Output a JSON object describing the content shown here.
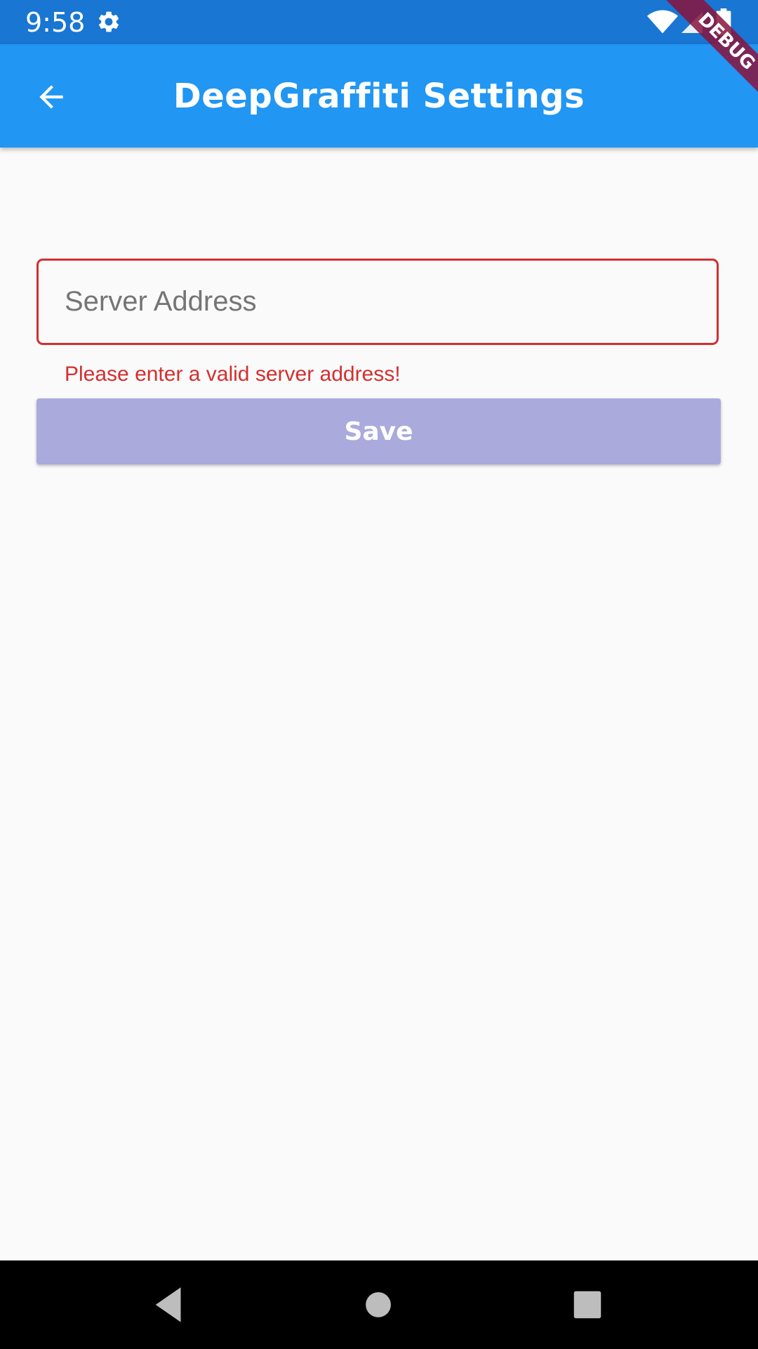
{
  "status_bar": {
    "time": "9:58",
    "icons": [
      "gear-icon",
      "wifi-icon",
      "signal-icon",
      "battery-icon"
    ]
  },
  "app_bar": {
    "title": "DeepGraffiti Settings",
    "back_icon": "arrow-back-icon",
    "color": "#2196f3"
  },
  "debug_banner": {
    "label": "DEBUG"
  },
  "form": {
    "server_address": {
      "placeholder": "Server Address",
      "value": "",
      "error": "Please enter a valid server address!"
    },
    "save_label": "Save"
  },
  "colors": {
    "status_bar": "#1976d2",
    "error": "#d32f2f",
    "save_button": "#aaaadc",
    "background": "#fafafa"
  },
  "nav_bar": {
    "icons": [
      "nav-back-icon",
      "nav-home-icon",
      "nav-recents-icon"
    ]
  }
}
